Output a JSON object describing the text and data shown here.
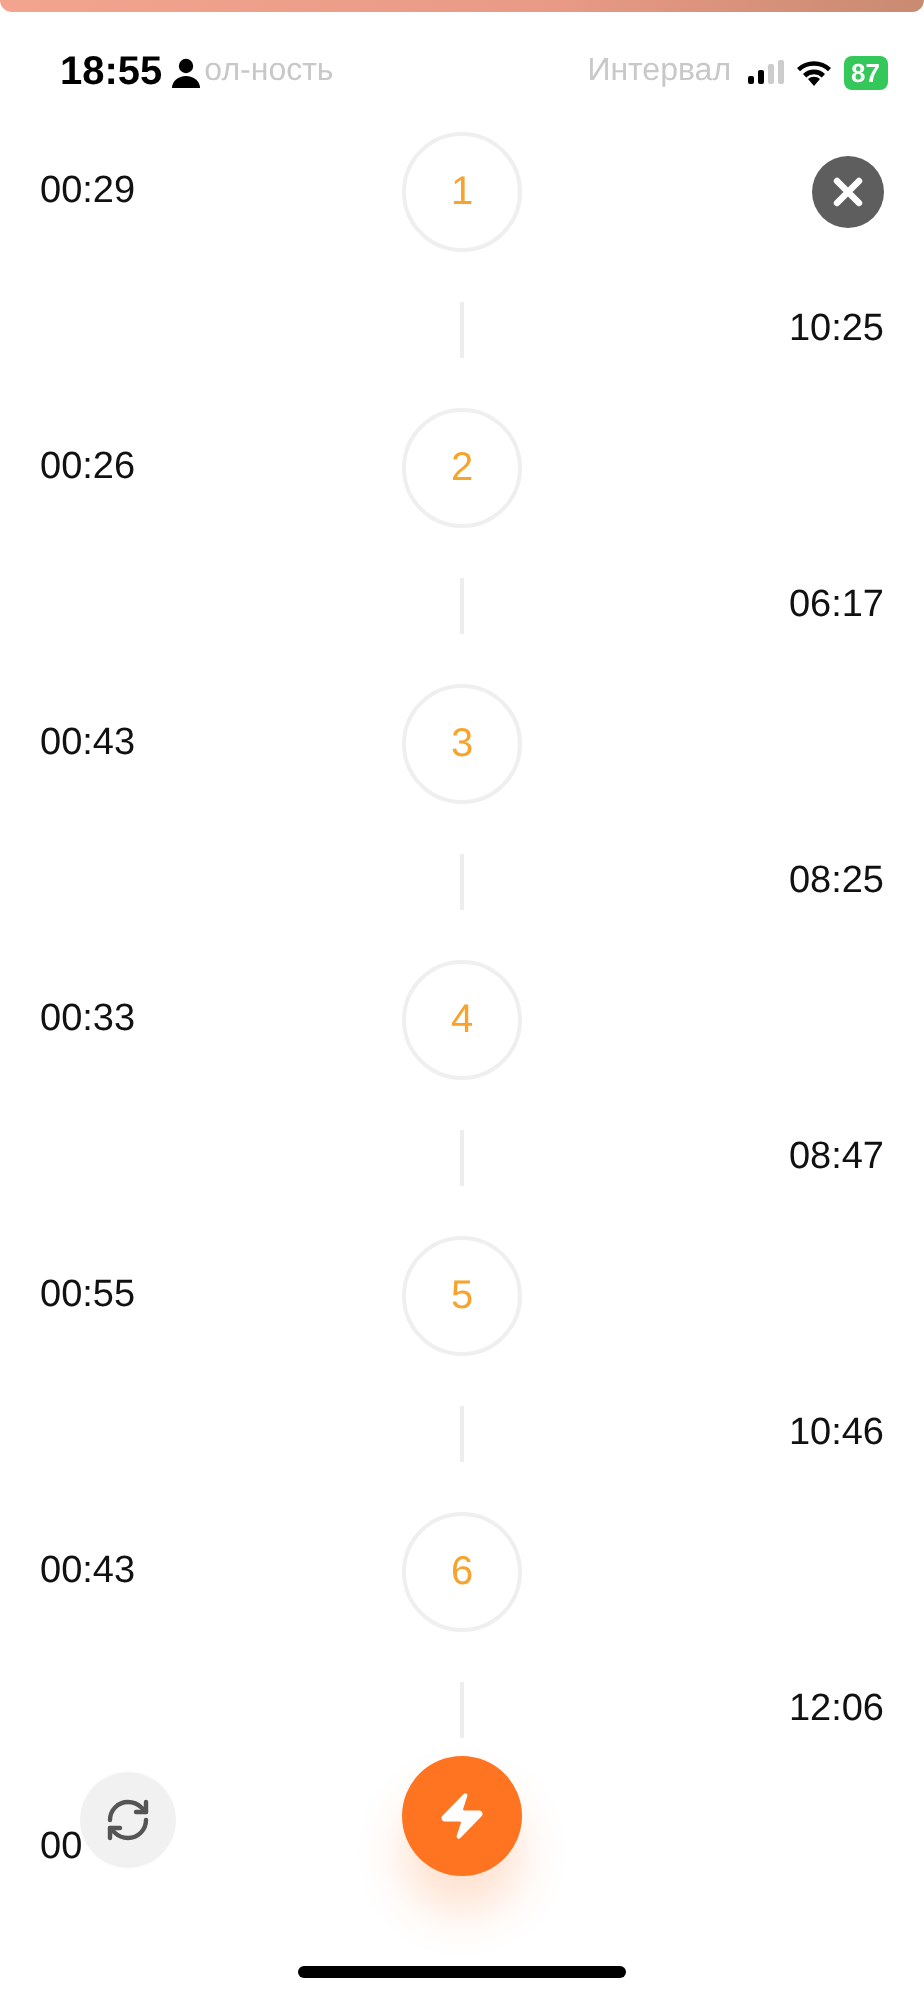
{
  "status_bar": {
    "time": "18:55",
    "battery": "87"
  },
  "header": {
    "left_label": "ол-ность",
    "right_label": "Интервал"
  },
  "steps": [
    {
      "left_time": "00:29",
      "number": "1",
      "right_time": "10:25"
    },
    {
      "left_time": "00:26",
      "number": "2",
      "right_time": "06:17"
    },
    {
      "left_time": "00:43",
      "number": "3",
      "right_time": "08:25"
    },
    {
      "left_time": "00:33",
      "number": "4",
      "right_time": "08:47"
    },
    {
      "left_time": "00:55",
      "number": "5",
      "right_time": "10:46"
    },
    {
      "left_time": "00:43",
      "number": "6",
      "right_time": "12:06"
    }
  ],
  "last_step": {
    "left_time": "00"
  }
}
